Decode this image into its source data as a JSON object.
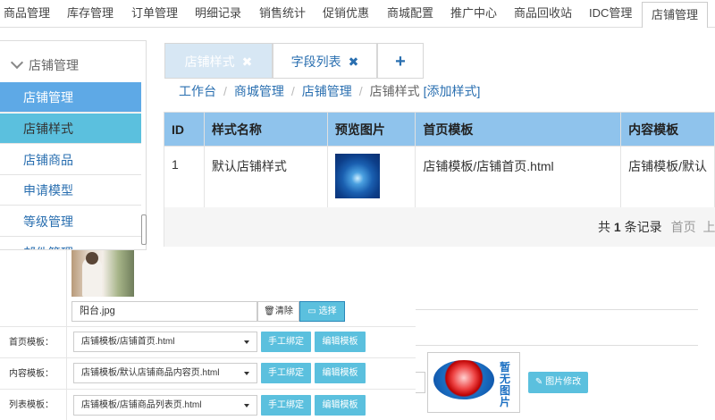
{
  "topnav": {
    "items": [
      "商品管理",
      "库存管理",
      "订单管理",
      "明细记录",
      "销售统计",
      "促销优惠",
      "商城配置",
      "推广中心",
      "商品回收站",
      "IDC管理",
      "店铺管理"
    ]
  },
  "sidebar": {
    "heading": "店铺管理",
    "items": [
      "店铺管理",
      "店铺样式",
      "店铺商品",
      "申请模型",
      "等级管理",
      "邮件管理"
    ]
  },
  "tabs": {
    "tab1": "店铺样式",
    "tab2": "字段列表",
    "add": "+",
    "close": "✖"
  },
  "breadcrumb": {
    "items": [
      "工作台",
      "商城管理",
      "店铺管理"
    ],
    "current": "店铺样式",
    "action": "[添加样式]",
    "separator": "/"
  },
  "table": {
    "headers": [
      "ID",
      "样式名称",
      "预览图片",
      "首页模板",
      "内容模板"
    ],
    "rows": [
      {
        "id": "1",
        "name": "默认店铺样式",
        "home": "店铺模板/店铺首页.html",
        "content": "店铺模板/默认"
      }
    ]
  },
  "pager": {
    "prefix": "共",
    "count": "1",
    "suffix": "条记录",
    "first": "首页",
    "prev": "上一"
  },
  "form": {
    "image_filename": "阳台.jpg",
    "clear_label": "清除",
    "choose_label": "选择",
    "rows": [
      {
        "label": "首页模板：",
        "value": "店铺模板/店铺首页.html",
        "bind": "手工绑定",
        "edit": "编辑模板"
      },
      {
        "label": "内容模板：",
        "value": "店铺模板/默认店铺商品内容页.html",
        "bind": "手工绑定",
        "edit": "编辑模板"
      },
      {
        "label": "列表模板：",
        "value": "店铺模板/店铺商品列表页.html",
        "bind": "手工绑定",
        "edit": "编辑模板"
      }
    ]
  },
  "noimage": {
    "text": "暂无图片",
    "edit_label": "图片修改"
  },
  "colors": {
    "accent": "#5ea9e6",
    "info": "#5bc0de",
    "table_header": "#8fc3ec",
    "link": "#2a6fb0"
  }
}
